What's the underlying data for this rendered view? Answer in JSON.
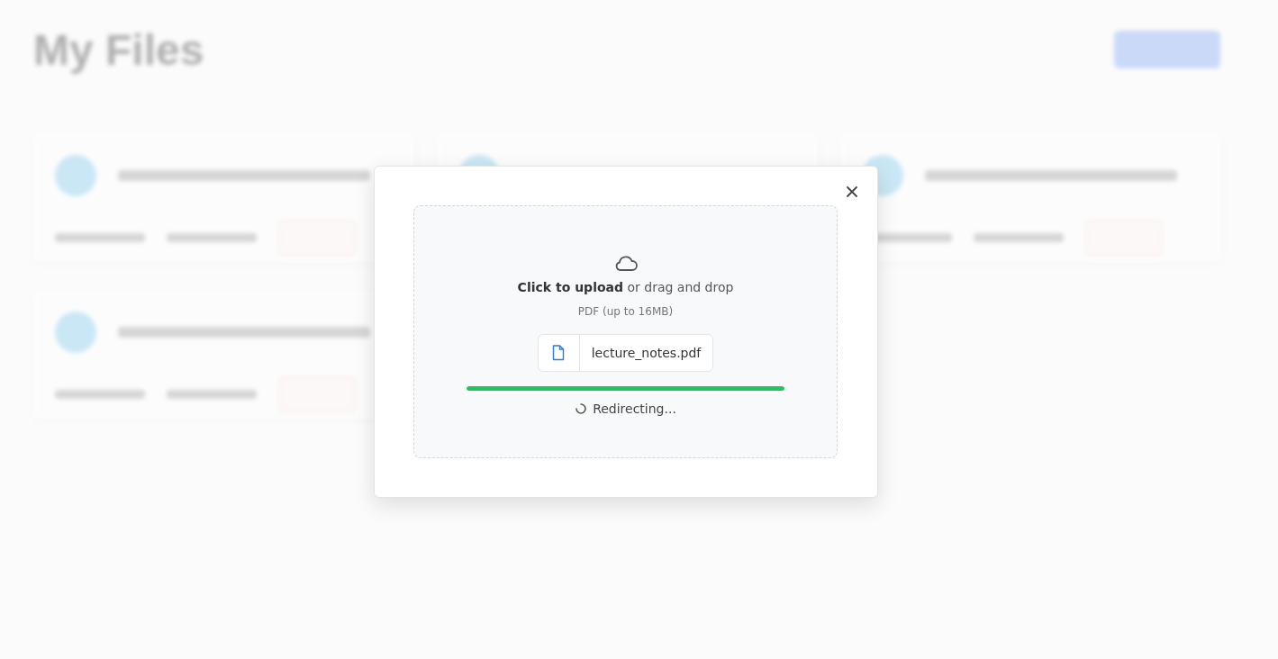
{
  "page": {
    "title": "My Files"
  },
  "upload_dialog": {
    "prompt": "**Click to upload** or drag and drop",
    "hint": "PDF (up to 16MB)",
    "file": {
      "name": "lecture_notes.pdf"
    },
    "progress": {
      "level": 1
    },
    "status": "Redirecting..."
  }
}
